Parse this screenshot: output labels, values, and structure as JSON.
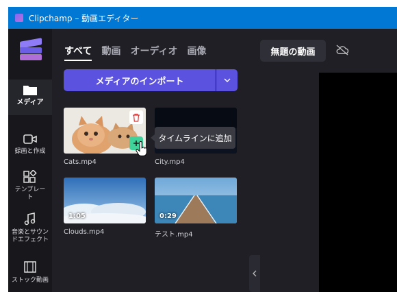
{
  "window": {
    "title": "Clipchamp – 動画エディター"
  },
  "sidebar": {
    "items": [
      {
        "label": "メディア",
        "icon": "folder-icon",
        "active": true
      },
      {
        "label": "録画と作成",
        "icon": "camera-icon"
      },
      {
        "label": "テンプレート",
        "icon": "templates-icon"
      },
      {
        "label": "音楽とサウンドエフェクト",
        "icon": "music-icon"
      },
      {
        "label": "ストック動画",
        "icon": "film-icon"
      }
    ]
  },
  "media": {
    "tabs": [
      "すべて",
      "動画",
      "オーディオ",
      "画像"
    ],
    "active_tab": "すべて",
    "import_label": "メディアのインポート",
    "files": [
      {
        "name": "Cats.mp4",
        "duration": ""
      },
      {
        "name": "City.mp4",
        "duration": ""
      },
      {
        "name": "Clouds.mp4",
        "duration": "1:05"
      },
      {
        "name": "テスト.mp4",
        "duration": "0:29"
      }
    ],
    "tooltip": "タイムラインに追加"
  },
  "editor": {
    "project_name": "無題の動画"
  },
  "colors": {
    "accent": "#5b52e0",
    "titlebar": "#0078d4",
    "add_green": "#3fd29a"
  }
}
